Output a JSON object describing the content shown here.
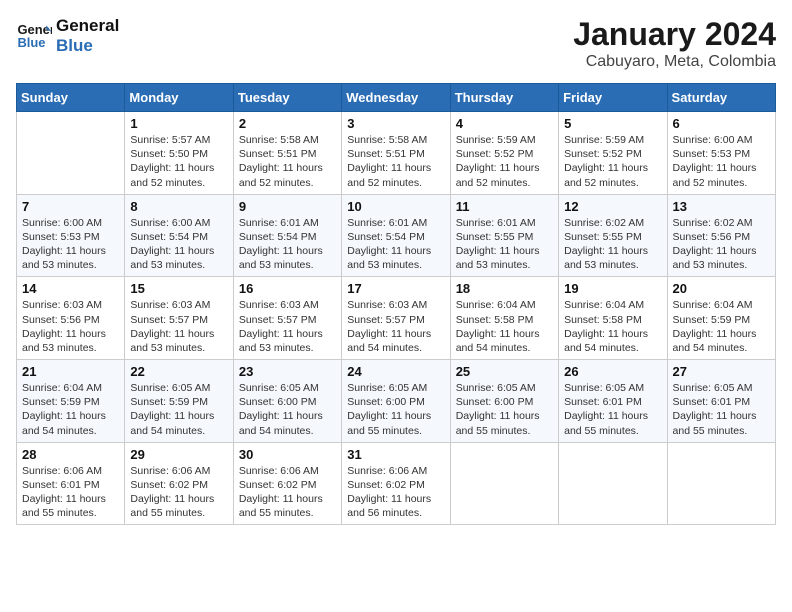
{
  "header": {
    "logo_line1": "General",
    "logo_line2": "Blue",
    "title": "January 2024",
    "subtitle": "Cabuyaro, Meta, Colombia"
  },
  "days_of_week": [
    "Sunday",
    "Monday",
    "Tuesday",
    "Wednesday",
    "Thursday",
    "Friday",
    "Saturday"
  ],
  "weeks": [
    [
      {
        "day": "",
        "info": ""
      },
      {
        "day": "1",
        "info": "Sunrise: 5:57 AM\nSunset: 5:50 PM\nDaylight: 11 hours\nand 52 minutes."
      },
      {
        "day": "2",
        "info": "Sunrise: 5:58 AM\nSunset: 5:51 PM\nDaylight: 11 hours\nand 52 minutes."
      },
      {
        "day": "3",
        "info": "Sunrise: 5:58 AM\nSunset: 5:51 PM\nDaylight: 11 hours\nand 52 minutes."
      },
      {
        "day": "4",
        "info": "Sunrise: 5:59 AM\nSunset: 5:52 PM\nDaylight: 11 hours\nand 52 minutes."
      },
      {
        "day": "5",
        "info": "Sunrise: 5:59 AM\nSunset: 5:52 PM\nDaylight: 11 hours\nand 52 minutes."
      },
      {
        "day": "6",
        "info": "Sunrise: 6:00 AM\nSunset: 5:53 PM\nDaylight: 11 hours\nand 52 minutes."
      }
    ],
    [
      {
        "day": "7",
        "info": "Sunrise: 6:00 AM\nSunset: 5:53 PM\nDaylight: 11 hours\nand 53 minutes."
      },
      {
        "day": "8",
        "info": "Sunrise: 6:00 AM\nSunset: 5:54 PM\nDaylight: 11 hours\nand 53 minutes."
      },
      {
        "day": "9",
        "info": "Sunrise: 6:01 AM\nSunset: 5:54 PM\nDaylight: 11 hours\nand 53 minutes."
      },
      {
        "day": "10",
        "info": "Sunrise: 6:01 AM\nSunset: 5:54 PM\nDaylight: 11 hours\nand 53 minutes."
      },
      {
        "day": "11",
        "info": "Sunrise: 6:01 AM\nSunset: 5:55 PM\nDaylight: 11 hours\nand 53 minutes."
      },
      {
        "day": "12",
        "info": "Sunrise: 6:02 AM\nSunset: 5:55 PM\nDaylight: 11 hours\nand 53 minutes."
      },
      {
        "day": "13",
        "info": "Sunrise: 6:02 AM\nSunset: 5:56 PM\nDaylight: 11 hours\nand 53 minutes."
      }
    ],
    [
      {
        "day": "14",
        "info": "Sunrise: 6:03 AM\nSunset: 5:56 PM\nDaylight: 11 hours\nand 53 minutes."
      },
      {
        "day": "15",
        "info": "Sunrise: 6:03 AM\nSunset: 5:57 PM\nDaylight: 11 hours\nand 53 minutes."
      },
      {
        "day": "16",
        "info": "Sunrise: 6:03 AM\nSunset: 5:57 PM\nDaylight: 11 hours\nand 53 minutes."
      },
      {
        "day": "17",
        "info": "Sunrise: 6:03 AM\nSunset: 5:57 PM\nDaylight: 11 hours\nand 54 minutes."
      },
      {
        "day": "18",
        "info": "Sunrise: 6:04 AM\nSunset: 5:58 PM\nDaylight: 11 hours\nand 54 minutes."
      },
      {
        "day": "19",
        "info": "Sunrise: 6:04 AM\nSunset: 5:58 PM\nDaylight: 11 hours\nand 54 minutes."
      },
      {
        "day": "20",
        "info": "Sunrise: 6:04 AM\nSunset: 5:59 PM\nDaylight: 11 hours\nand 54 minutes."
      }
    ],
    [
      {
        "day": "21",
        "info": "Sunrise: 6:04 AM\nSunset: 5:59 PM\nDaylight: 11 hours\nand 54 minutes."
      },
      {
        "day": "22",
        "info": "Sunrise: 6:05 AM\nSunset: 5:59 PM\nDaylight: 11 hours\nand 54 minutes."
      },
      {
        "day": "23",
        "info": "Sunrise: 6:05 AM\nSunset: 6:00 PM\nDaylight: 11 hours\nand 54 minutes."
      },
      {
        "day": "24",
        "info": "Sunrise: 6:05 AM\nSunset: 6:00 PM\nDaylight: 11 hours\nand 55 minutes."
      },
      {
        "day": "25",
        "info": "Sunrise: 6:05 AM\nSunset: 6:00 PM\nDaylight: 11 hours\nand 55 minutes."
      },
      {
        "day": "26",
        "info": "Sunrise: 6:05 AM\nSunset: 6:01 PM\nDaylight: 11 hours\nand 55 minutes."
      },
      {
        "day": "27",
        "info": "Sunrise: 6:05 AM\nSunset: 6:01 PM\nDaylight: 11 hours\nand 55 minutes."
      }
    ],
    [
      {
        "day": "28",
        "info": "Sunrise: 6:06 AM\nSunset: 6:01 PM\nDaylight: 11 hours\nand 55 minutes."
      },
      {
        "day": "29",
        "info": "Sunrise: 6:06 AM\nSunset: 6:02 PM\nDaylight: 11 hours\nand 55 minutes."
      },
      {
        "day": "30",
        "info": "Sunrise: 6:06 AM\nSunset: 6:02 PM\nDaylight: 11 hours\nand 55 minutes."
      },
      {
        "day": "31",
        "info": "Sunrise: 6:06 AM\nSunset: 6:02 PM\nDaylight: 11 hours\nand 56 minutes."
      },
      {
        "day": "",
        "info": ""
      },
      {
        "day": "",
        "info": ""
      },
      {
        "day": "",
        "info": ""
      }
    ]
  ]
}
